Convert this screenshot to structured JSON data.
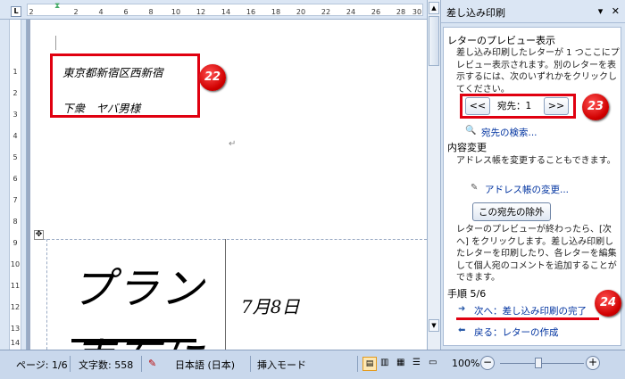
{
  "ruler": {
    "corner": "L",
    "numbers": [
      "2",
      "2",
      "4",
      "6",
      "8",
      "10",
      "12",
      "14",
      "16",
      "18",
      "20",
      "22",
      "24",
      "26",
      "28",
      "30"
    ],
    "v_numbers": [
      "1",
      "2",
      "3",
      "4",
      "5",
      "6",
      "7",
      "8",
      "9",
      "10",
      "11",
      "12",
      "13",
      "14"
    ]
  },
  "document": {
    "addr_line1": "東京都新宿区西新宿",
    "addr_line2": "下衆　ヤバ男様",
    "big1": "プラン",
    "big2": "表石に",
    "date": "7月8日"
  },
  "badges": {
    "b22": "22",
    "b23": "23",
    "b24": "24"
  },
  "pane": {
    "title": "差し込み印刷",
    "preview_heading": "レターのプレビュー表示",
    "preview_desc": "差し込み印刷したレターが 1 つここにプレビュー表示されます。別のレターを表示するには、次のいずれかをクリックしてください。",
    "prev_btn": "<<",
    "recipient_label": "宛先：1",
    "next_btn": ">>",
    "find_recipient": "宛先の検索...",
    "edit_heading": "内容変更",
    "edit_desc": "アドレス帳を変更することもできます。",
    "edit_addressbook": "アドレス帳の変更...",
    "exclude_btn": "この宛先の除外",
    "finish_desc": "レターのプレビューが終わったら、[次へ] をクリックします。差し込み印刷したレターを印刷したり、各レターを編集して個人宛のコメントを追加することができます。",
    "step": "手順 5/6",
    "next_link": "次へ：差し込み印刷の完了",
    "back_link": "戻る：レターの作成"
  },
  "status": {
    "page": "ページ: 1/6",
    "words": "文字数: 558",
    "lang": "日本語 (日本)",
    "mode": "挿入モード",
    "zoom": "100%"
  }
}
